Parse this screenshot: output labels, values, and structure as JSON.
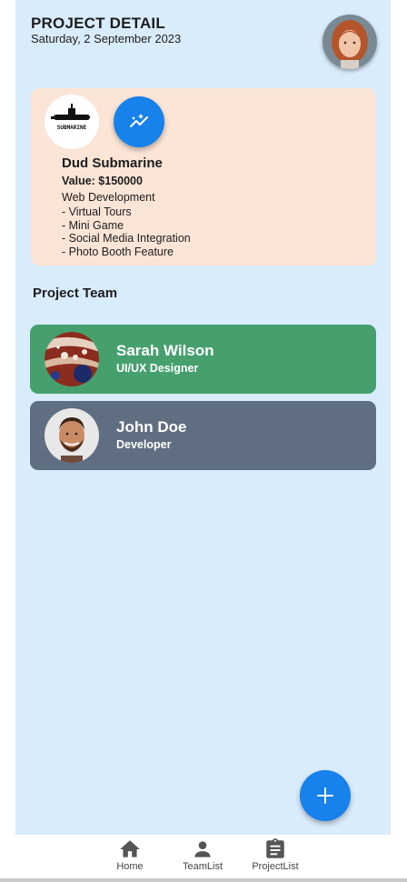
{
  "header": {
    "title": "PROJECT DETAIL",
    "date": "Saturday, 2 September 2023"
  },
  "project": {
    "logo_text": "SUBMARINE",
    "name": "Dud Submarine",
    "value": "Value: $150000",
    "category": "Web Development",
    "features": [
      "- Virtual Tours",
      "- Mini Game",
      "- Social Media Integration",
      "- Photo Booth Feature"
    ]
  },
  "team": {
    "title": "Project Team",
    "members": [
      {
        "name": "Sarah Wilson",
        "role": "UI/UX Designer",
        "color": "#46a06e"
      },
      {
        "name": "John Doe",
        "role": "Developer",
        "color": "#5f6e80"
      }
    ]
  },
  "nav": {
    "items": [
      {
        "label": "Home",
        "icon": "home-icon"
      },
      {
        "label": "TeamList",
        "icon": "person-icon"
      },
      {
        "label": "ProjectList",
        "icon": "clipboard-icon"
      }
    ]
  },
  "colors": {
    "background": "#d9ecfc",
    "card": "#fbe5d6",
    "accent": "#1781ec"
  }
}
